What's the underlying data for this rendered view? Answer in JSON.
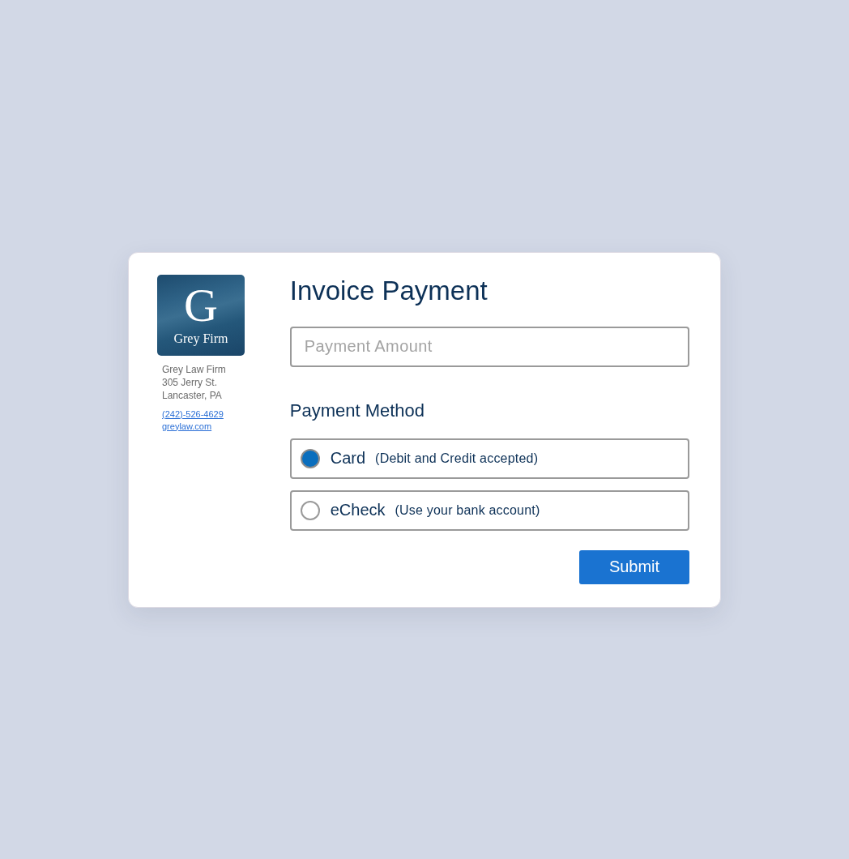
{
  "logo": {
    "letter": "G",
    "name": "Grey Firm"
  },
  "firm": {
    "address": [
      "Grey Law Firm",
      "305 Jerry St.",
      "Lancaster, PA"
    ],
    "phone": "(242)-526-4629",
    "website": "greylaw.com"
  },
  "form": {
    "title": "Invoice Payment",
    "amount": {
      "placeholder": "Payment Amount"
    },
    "method_heading": "Payment Method",
    "methods": [
      {
        "label": "Card",
        "note": "(Debit and Credit accepted)",
        "selected": true
      },
      {
        "label": "eCheck",
        "note": "(Use your bank account)",
        "selected": false
      }
    ],
    "submit": "Submit"
  }
}
